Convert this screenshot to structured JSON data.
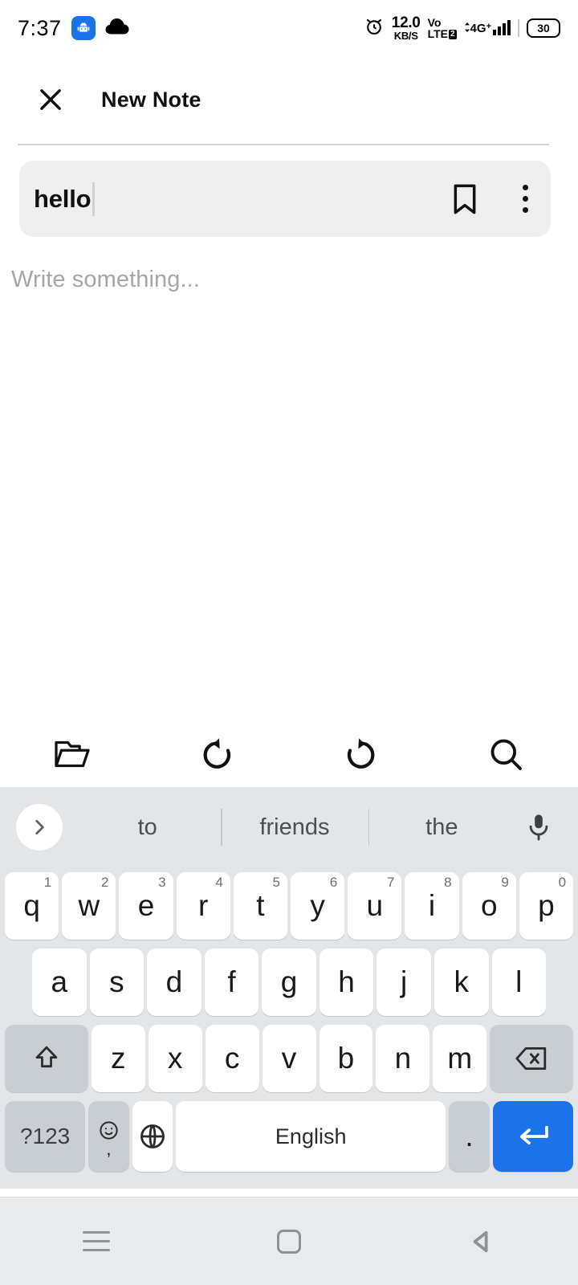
{
  "status_bar": {
    "time": "7:37",
    "icons_left": [
      "android-robot-icon",
      "cloud-icon"
    ],
    "alarm_icon": "alarm-clock-icon",
    "net_speed_value": "12.0",
    "net_speed_unit": "KB/S",
    "volte_line1": "Vo",
    "volte_line2": "LTE",
    "volte_badge": "2",
    "signal_label": "4G",
    "signal_plus": "+",
    "battery_level": "30"
  },
  "app_bar": {
    "close_icon": "close-icon",
    "title": "New Note"
  },
  "note": {
    "title_value": "hello",
    "title_placeholder": "Title",
    "bookmark_icon": "bookmark-icon",
    "overflow_icon": "more-vertical-icon",
    "body_value": "",
    "body_placeholder": "Write something..."
  },
  "editor_toolbar": {
    "items": [
      {
        "name": "folder-icon",
        "label": "Folder"
      },
      {
        "name": "undo-icon",
        "label": "Undo"
      },
      {
        "name": "redo-icon",
        "label": "Redo"
      },
      {
        "name": "search-icon",
        "label": "Search"
      }
    ]
  },
  "keyboard": {
    "suggestions": [
      "to",
      "friends",
      "the"
    ],
    "expand_icon": "chevron-right-icon",
    "mic_icon": "microphone-icon",
    "row1": [
      {
        "key": "q",
        "num": "1"
      },
      {
        "key": "w",
        "num": "2"
      },
      {
        "key": "e",
        "num": "3"
      },
      {
        "key": "r",
        "num": "4"
      },
      {
        "key": "t",
        "num": "5"
      },
      {
        "key": "y",
        "num": "6"
      },
      {
        "key": "u",
        "num": "7"
      },
      {
        "key": "i",
        "num": "8"
      },
      {
        "key": "o",
        "num": "9"
      },
      {
        "key": "p",
        "num": "0"
      }
    ],
    "row2": [
      "a",
      "s",
      "d",
      "f",
      "g",
      "h",
      "j",
      "k",
      "l"
    ],
    "row3_letters": [
      "z",
      "x",
      "c",
      "v",
      "b",
      "n",
      "m"
    ],
    "shift_icon": "shift-icon",
    "backspace_icon": "backspace-icon",
    "symbols_label": "?123",
    "emoji_icon": "emoji-icon",
    "comma_label": ",",
    "globe_icon": "globe-icon",
    "space_label": "English",
    "period_label": ".",
    "enter_icon": "enter-icon",
    "enter_color": "#1a73e8"
  },
  "nav_bar": {
    "recents_icon": "recents-icon",
    "home_icon": "home-icon",
    "back_icon": "back-icon"
  }
}
